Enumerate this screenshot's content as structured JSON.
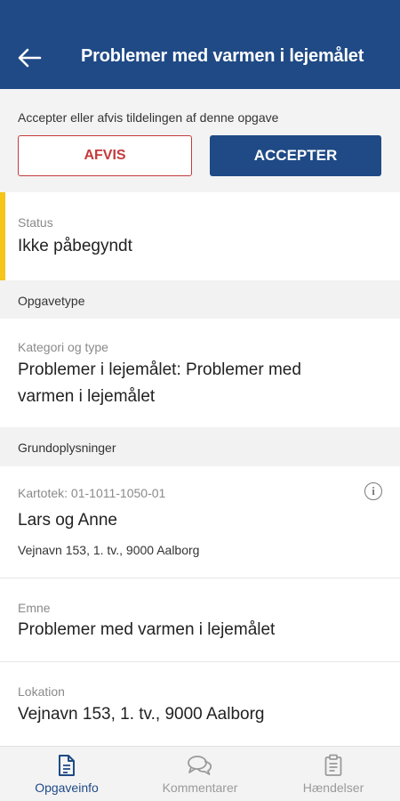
{
  "header": {
    "title": "Problemer med varmen i lejemålet",
    "back_icon": "arrow-left-icon"
  },
  "assignment": {
    "prompt": "Accepter eller afvis tildelingen af denne opgave",
    "reject_label": "AFVIS",
    "accept_label": "ACCEPTER"
  },
  "status": {
    "label": "Status",
    "value": "Ikke påbegyndt",
    "accent_color": "#f5c518"
  },
  "task_type": {
    "section_title": "Opgavetype",
    "label": "Kategori og type",
    "value_line1": "Problemer i lejemålet: Problemer med",
    "value_line2": "varmen i lejemålet"
  },
  "basic_info": {
    "section_title": "Grundoplysninger",
    "file_label": "Kartotek: 01-1011-1050-01",
    "tenant_name": "Lars og Anne",
    "address": "Vejnavn 153, 1. tv., 9000 Aalborg",
    "subject_label": "Emne",
    "subject_value": "Problemer med varmen i lejemålet",
    "location_label": "Lokation",
    "location_value": "Vejnavn 153, 1. tv., 9000 Aalborg",
    "info_icon": "i"
  },
  "bottom_nav": {
    "items": [
      {
        "label": "Opgaveinfo",
        "icon": "document-icon",
        "active": true
      },
      {
        "label": "Kommentarer",
        "icon": "chat-icon",
        "active": false
      },
      {
        "label": "Hændelser",
        "icon": "clipboard-icon",
        "active": false
      }
    ]
  },
  "colors": {
    "primary": "#1f4a86",
    "reject": "#c43b3b",
    "status_accent": "#f5c518"
  }
}
